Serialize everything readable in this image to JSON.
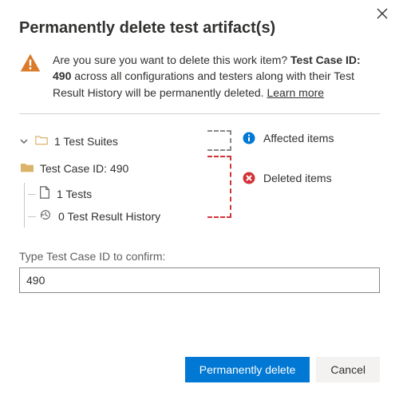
{
  "dialog": {
    "title": "Permanently delete test artifact(s)",
    "warning": {
      "prefix": "Are you sure you want to delete this work item? ",
      "bold": "Test Case ID: 490",
      "suffix": " across all configurations and testers along with their Test Result History will be permanently deleted. ",
      "learn_more": "Learn more"
    },
    "tree": {
      "suites": "1 Test Suites",
      "case": "Test Case ID: 490",
      "tests": "1 Tests",
      "history": "0 Test Result History"
    },
    "legend": {
      "affected": "Affected items",
      "deleted": "Deleted items"
    },
    "confirm_label": "Type Test Case ID to confirm:",
    "confirm_value": "490",
    "buttons": {
      "delete": "Permanently delete",
      "cancel": "Cancel"
    }
  }
}
